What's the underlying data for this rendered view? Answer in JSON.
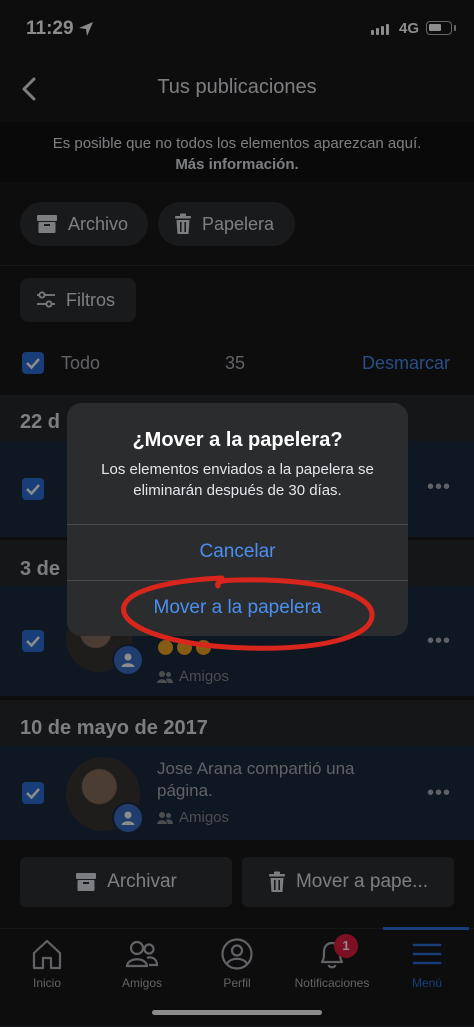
{
  "status_bar": {
    "time": "11:29",
    "network": "4G"
  },
  "header": {
    "title": "Tus publicaciones"
  },
  "notice": {
    "text": "Es posible que no todos los elementos aparezcan aquí.",
    "link": "Más información."
  },
  "filters": {
    "archivo": "Archivo",
    "papelera": "Papelera",
    "filtros": "Filtros"
  },
  "select_all": {
    "label": "Todo",
    "count": "35",
    "unmark": "Desmarcar"
  },
  "sections": {
    "s1": {
      "date": "22 d"
    },
    "s2": {
      "date": "3 de"
    },
    "s3": {
      "date": "10 de mayo de 2017"
    }
  },
  "posts": {
    "p2": {
      "audience": "Amigos"
    },
    "p3": {
      "text": "Jose Arana compartió una página.",
      "audience": "Amigos"
    }
  },
  "actions": {
    "archivar": "Archivar",
    "mover": "Mover a pape..."
  },
  "tabs": {
    "inicio": "Inicio",
    "amigos": "Amigos",
    "perfil": "Perfil",
    "notificaciones": "Notificaciones",
    "menu": "Menú",
    "notif_count": "1"
  },
  "dialog": {
    "title": "¿Mover a la papelera?",
    "message": "Los elementos enviados a la papelera se eliminarán después de 30 días.",
    "cancel": "Cancelar",
    "confirm": "Mover a la papelera"
  },
  "colors": {
    "accent": "#2d6fdb",
    "link": "#4b8ff0",
    "annotation": "#d8261c",
    "badge": "#e41e3f"
  }
}
